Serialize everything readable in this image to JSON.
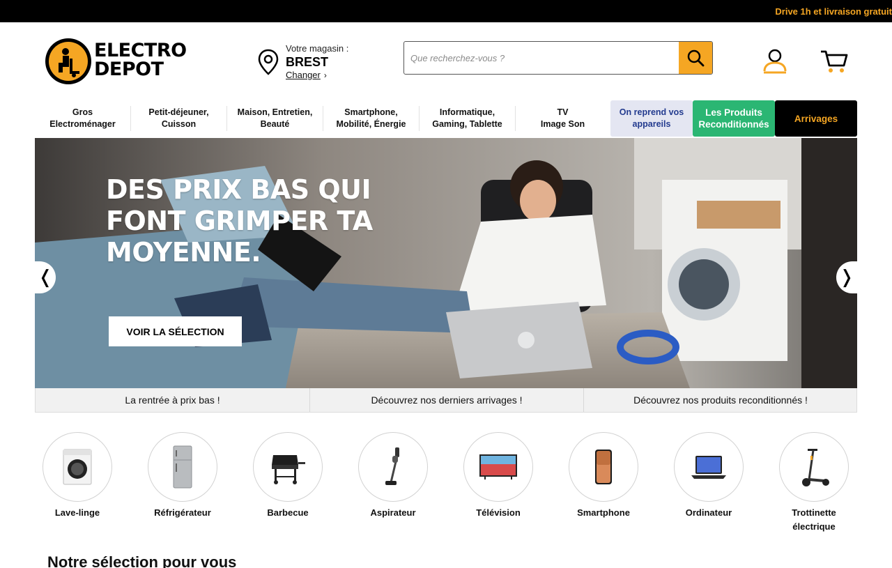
{
  "promo": {
    "text": "Drive 1h et livraison gratuit"
  },
  "brand": {
    "line1": "ELECTRO",
    "line2": "DEPOT",
    "accent_color": "#f5a623"
  },
  "store": {
    "label": "Votre magasin :",
    "name": "BREST",
    "change": "Changer"
  },
  "search": {
    "placeholder": "Que recherchez-vous ?",
    "value": "",
    "icon": "search-icon"
  },
  "header_icons": {
    "account": "user-icon",
    "cart": "cart-icon"
  },
  "nav": {
    "items": [
      {
        "line1": "Gros",
        "line2": "Electroménager"
      },
      {
        "line1": "Petit-déjeuner,",
        "line2": "Cuisson"
      },
      {
        "line1": "Maison, Entretien,",
        "line2": "Beauté"
      },
      {
        "line1": "Smartphone,",
        "line2": "Mobilité, Énergie"
      },
      {
        "line1": "Informatique,",
        "line2": "Gaming, Tablette"
      },
      {
        "line1": "TV",
        "line2": "Image Son"
      }
    ],
    "reprend": {
      "line1": "On reprend vos",
      "line2": "appareils"
    },
    "reconditionnes": {
      "line1": "Les Produits",
      "line2": "Reconditionnés"
    },
    "arrivages": "Arrivages"
  },
  "hero": {
    "title": "DES PRIX BAS QUI\nFONT GRIMPER TA\nMOYENNE.",
    "cta": "VOIR LA SÉLECTION",
    "prev": "❬",
    "next": "❭",
    "tabs": [
      "La rentrée à prix bas !",
      "Découvrez nos derniers arrivages !",
      "Découvrez nos produits reconditionnés !"
    ]
  },
  "categories": [
    {
      "label": "Lave-linge",
      "icon": "washing-machine-icon"
    },
    {
      "label": "Réfrigérateur",
      "icon": "fridge-icon"
    },
    {
      "label": "Barbecue",
      "icon": "barbecue-icon"
    },
    {
      "label": "Aspirateur",
      "icon": "vacuum-icon"
    },
    {
      "label": "Télévision",
      "icon": "tv-icon"
    },
    {
      "label": "Smartphone",
      "icon": "smartphone-icon"
    },
    {
      "label": "Ordinateur",
      "icon": "laptop-icon"
    },
    {
      "label": "Trottinette électrique",
      "icon": "scooter-icon"
    }
  ],
  "section": {
    "title": "Notre sélection pour vous"
  }
}
